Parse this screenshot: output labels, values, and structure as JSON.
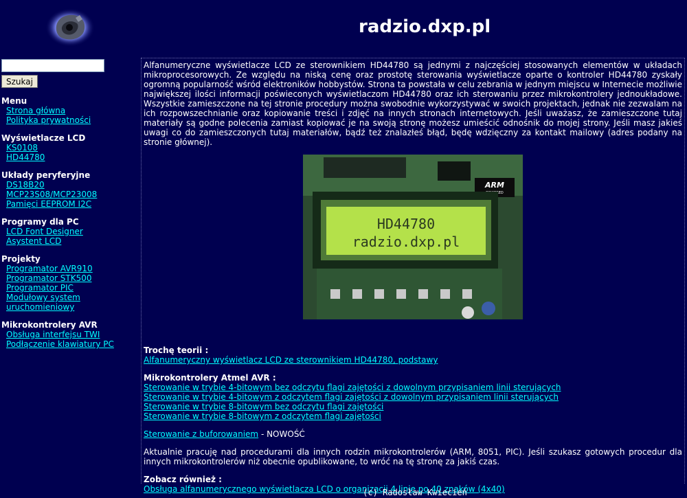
{
  "site_title": "radzio.dxp.pl",
  "search": {
    "placeholder": "",
    "button_label": "Szukaj"
  },
  "sidebar": {
    "groups": [
      {
        "title": "Menu",
        "items": [
          "Strona główna",
          "Polityka prywatności"
        ]
      },
      {
        "title": "Wyświetlacze LCD",
        "items": [
          "KS0108",
          "HD44780"
        ]
      },
      {
        "title": "Układy peryferyjne",
        "items": [
          "DS18B20",
          "MCP23S08/MCP23008",
          "Pamięci EEPROM I2C"
        ]
      },
      {
        "title": "Programy dla PC",
        "items": [
          "LCD Font Designer",
          "Asystent LCD"
        ]
      },
      {
        "title": "Projekty",
        "items": [
          "Programator AVR910",
          "Programator STK500",
          "Programator PIC",
          "Modułowy system uruchomieniowy"
        ]
      },
      {
        "title": "Mikrokontrolery AVR",
        "items": [
          "Obsługa interfejsu TWI",
          "Podłączenie klawiatury PC"
        ]
      }
    ]
  },
  "main": {
    "intro": "Alfanumeryczne wyświetlacze LCD ze sterownikiem HD44780 są jednymi z najczęściej stosowanych elementów w układach mikroprocesorowych. Ze względu na niską cenę oraz prostotę sterowania wyświetlacze oparte o kontroler HD44780 zyskały ogromną popularność wśród elektroników hobbystów. Strona ta powstała w celu zebrania w jednym miejscu w Internecie możliwie największej ilości informacji poświeconych wyświetlaczom HD44780 oraz ich sterowaniu przez mikrokontrolery jednoukładowe. Wszystkie zamieszczone na tej stronie procedury można swobodnie wykorzystywać w swoich projektach, jednak nie zezwalam na ich rozpowszechnianie oraz kopiowanie treści i zdjęć na innych stronach internetowych. Jeśli uważasz, że zamieszczone tutaj materiały są godne polecenia zamiast kopiować je na swoją stronę możesz umieścić odnośnik do mojej strony. Jeśli masz jakieś uwagi co do zamieszczonych tutaj materiałów, bądź też znalazłeś błąd, będę wdzięczny za kontakt mailowy (adres podany na stronie głównej).",
    "photo": {
      "lcd_line1": "HD44780",
      "lcd_line2": "radzio.dxp.pl",
      "board_label": "ARM",
      "board_sublabel": "POWERED"
    },
    "theory": {
      "heading": "Trochę teorii :",
      "link": "Alfanumeryczny wyświetlacz LCD ze sterownikiem HD44780, podstawy"
    },
    "avr": {
      "heading": "Mikrokontrolery Atmel AVR :",
      "links": [
        "Sterowanie w trybie 4-bitowym bez odczytu flagi zajętości z dowolnym przypisaniem linii sterujących",
        "Sterowanie w trybie 4-bitowym z odczytem flagi zajętości z dowolnym przypisaniem linii sterujących",
        "Sterowanie w trybie 8-bitowym bez odczytu flagi zajętości",
        "Sterowanie w trybie 8-bitowym z odczytem flagi zajętości"
      ],
      "buffered_link": "Sterowanie z buforowaniem",
      "buffered_suffix": " - NOWOŚĆ"
    },
    "note": "Aktualnie pracuję nad procedurami dla innych rodzin mikrokontrolerów (ARM, 8051, PIC). Jeśli szukasz gotowych procedur dla innych mikrokontrolerów niż obecnie opublikowane, to wróć na tę stronę za jakiś czas.",
    "see_also": {
      "heading": "Zobacz również :",
      "link": "Obsługa alfanumerycznego wyświetlacza LCD o organizacji 4 linie po 40 znaków (4x40)"
    }
  },
  "footer": "(c) Radosław Kwiecień",
  "colors": {
    "background": "#000050",
    "link": "#00ffff",
    "text": "#ffffff",
    "lcd_screen": "#b4e14a"
  }
}
